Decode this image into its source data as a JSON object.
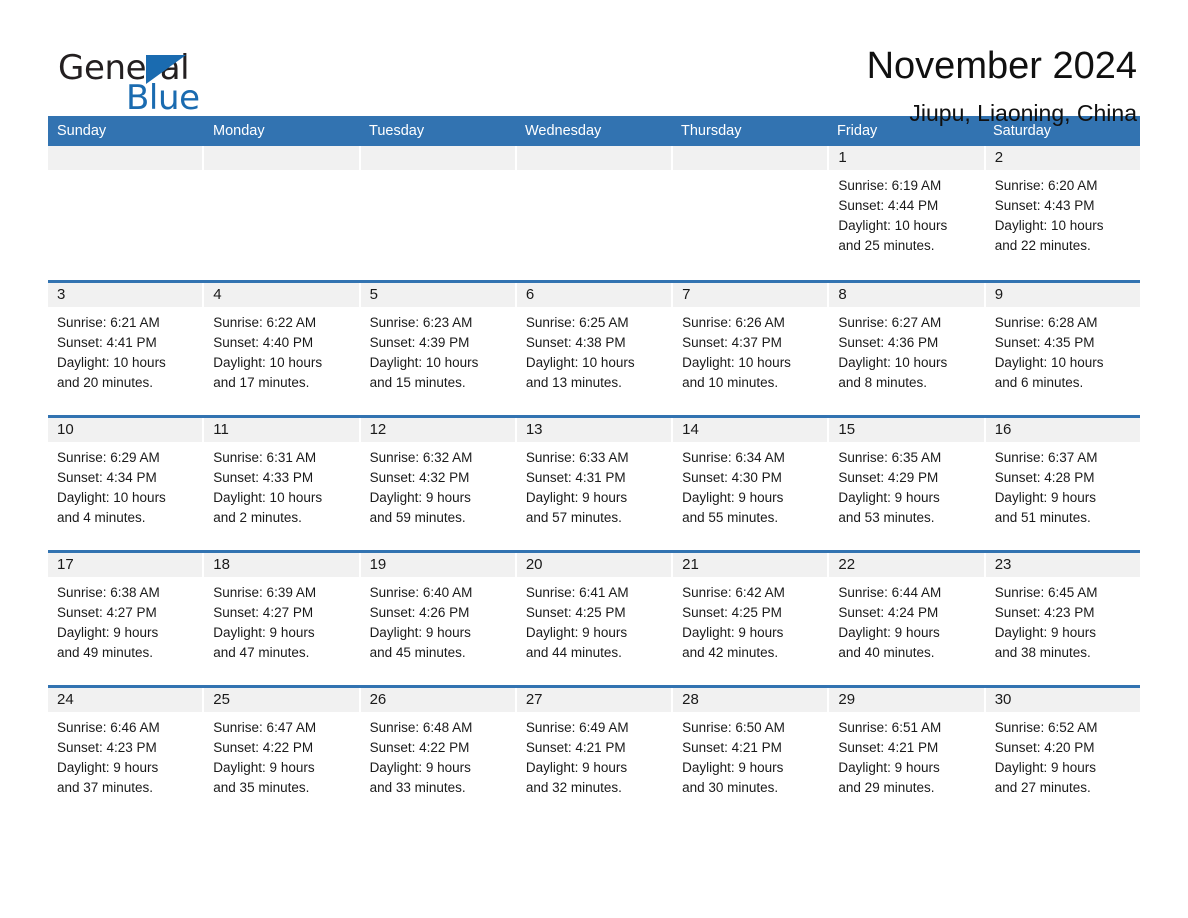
{
  "brand": {
    "name_part1": "General",
    "name_part2": "Blue",
    "triangle_color": "#1a6bb0"
  },
  "header": {
    "month_title": "November 2024",
    "location": "Jiupu, Liaoning, China"
  },
  "theme": {
    "header_blue": "#3273b1",
    "day_band_gray": "#f1f1f1",
    "text": "#1a1a1a",
    "page_background": "#ffffff"
  },
  "weekdays": [
    "Sunday",
    "Monday",
    "Tuesday",
    "Wednesday",
    "Thursday",
    "Friday",
    "Saturday"
  ],
  "weeks": [
    [
      {
        "day": "",
        "empty": true
      },
      {
        "day": "",
        "empty": true
      },
      {
        "day": "",
        "empty": true
      },
      {
        "day": "",
        "empty": true
      },
      {
        "day": "",
        "empty": true
      },
      {
        "day": "1",
        "sunrise": "Sunrise: 6:19 AM",
        "sunset": "Sunset: 4:44 PM",
        "daylight1": "Daylight: 10 hours",
        "daylight2": "and 25 minutes."
      },
      {
        "day": "2",
        "sunrise": "Sunrise: 6:20 AM",
        "sunset": "Sunset: 4:43 PM",
        "daylight1": "Daylight: 10 hours",
        "daylight2": "and 22 minutes."
      }
    ],
    [
      {
        "day": "3",
        "sunrise": "Sunrise: 6:21 AM",
        "sunset": "Sunset: 4:41 PM",
        "daylight1": "Daylight: 10 hours",
        "daylight2": "and 20 minutes."
      },
      {
        "day": "4",
        "sunrise": "Sunrise: 6:22 AM",
        "sunset": "Sunset: 4:40 PM",
        "daylight1": "Daylight: 10 hours",
        "daylight2": "and 17 minutes."
      },
      {
        "day": "5",
        "sunrise": "Sunrise: 6:23 AM",
        "sunset": "Sunset: 4:39 PM",
        "daylight1": "Daylight: 10 hours",
        "daylight2": "and 15 minutes."
      },
      {
        "day": "6",
        "sunrise": "Sunrise: 6:25 AM",
        "sunset": "Sunset: 4:38 PM",
        "daylight1": "Daylight: 10 hours",
        "daylight2": "and 13 minutes."
      },
      {
        "day": "7",
        "sunrise": "Sunrise: 6:26 AM",
        "sunset": "Sunset: 4:37 PM",
        "daylight1": "Daylight: 10 hours",
        "daylight2": "and 10 minutes."
      },
      {
        "day": "8",
        "sunrise": "Sunrise: 6:27 AM",
        "sunset": "Sunset: 4:36 PM",
        "daylight1": "Daylight: 10 hours",
        "daylight2": "and 8 minutes."
      },
      {
        "day": "9",
        "sunrise": "Sunrise: 6:28 AM",
        "sunset": "Sunset: 4:35 PM",
        "daylight1": "Daylight: 10 hours",
        "daylight2": "and 6 minutes."
      }
    ],
    [
      {
        "day": "10",
        "sunrise": "Sunrise: 6:29 AM",
        "sunset": "Sunset: 4:34 PM",
        "daylight1": "Daylight: 10 hours",
        "daylight2": "and 4 minutes."
      },
      {
        "day": "11",
        "sunrise": "Sunrise: 6:31 AM",
        "sunset": "Sunset: 4:33 PM",
        "daylight1": "Daylight: 10 hours",
        "daylight2": "and 2 minutes."
      },
      {
        "day": "12",
        "sunrise": "Sunrise: 6:32 AM",
        "sunset": "Sunset: 4:32 PM",
        "daylight1": "Daylight: 9 hours",
        "daylight2": "and 59 minutes."
      },
      {
        "day": "13",
        "sunrise": "Sunrise: 6:33 AM",
        "sunset": "Sunset: 4:31 PM",
        "daylight1": "Daylight: 9 hours",
        "daylight2": "and 57 minutes."
      },
      {
        "day": "14",
        "sunrise": "Sunrise: 6:34 AM",
        "sunset": "Sunset: 4:30 PM",
        "daylight1": "Daylight: 9 hours",
        "daylight2": "and 55 minutes."
      },
      {
        "day": "15",
        "sunrise": "Sunrise: 6:35 AM",
        "sunset": "Sunset: 4:29 PM",
        "daylight1": "Daylight: 9 hours",
        "daylight2": "and 53 minutes."
      },
      {
        "day": "16",
        "sunrise": "Sunrise: 6:37 AM",
        "sunset": "Sunset: 4:28 PM",
        "daylight1": "Daylight: 9 hours",
        "daylight2": "and 51 minutes."
      }
    ],
    [
      {
        "day": "17",
        "sunrise": "Sunrise: 6:38 AM",
        "sunset": "Sunset: 4:27 PM",
        "daylight1": "Daylight: 9 hours",
        "daylight2": "and 49 minutes."
      },
      {
        "day": "18",
        "sunrise": "Sunrise: 6:39 AM",
        "sunset": "Sunset: 4:27 PM",
        "daylight1": "Daylight: 9 hours",
        "daylight2": "and 47 minutes."
      },
      {
        "day": "19",
        "sunrise": "Sunrise: 6:40 AM",
        "sunset": "Sunset: 4:26 PM",
        "daylight1": "Daylight: 9 hours",
        "daylight2": "and 45 minutes."
      },
      {
        "day": "20",
        "sunrise": "Sunrise: 6:41 AM",
        "sunset": "Sunset: 4:25 PM",
        "daylight1": "Daylight: 9 hours",
        "daylight2": "and 44 minutes."
      },
      {
        "day": "21",
        "sunrise": "Sunrise: 6:42 AM",
        "sunset": "Sunset: 4:25 PM",
        "daylight1": "Daylight: 9 hours",
        "daylight2": "and 42 minutes."
      },
      {
        "day": "22",
        "sunrise": "Sunrise: 6:44 AM",
        "sunset": "Sunset: 4:24 PM",
        "daylight1": "Daylight: 9 hours",
        "daylight2": "and 40 minutes."
      },
      {
        "day": "23",
        "sunrise": "Sunrise: 6:45 AM",
        "sunset": "Sunset: 4:23 PM",
        "daylight1": "Daylight: 9 hours",
        "daylight2": "and 38 minutes."
      }
    ],
    [
      {
        "day": "24",
        "sunrise": "Sunrise: 6:46 AM",
        "sunset": "Sunset: 4:23 PM",
        "daylight1": "Daylight: 9 hours",
        "daylight2": "and 37 minutes."
      },
      {
        "day": "25",
        "sunrise": "Sunrise: 6:47 AM",
        "sunset": "Sunset: 4:22 PM",
        "daylight1": "Daylight: 9 hours",
        "daylight2": "and 35 minutes."
      },
      {
        "day": "26",
        "sunrise": "Sunrise: 6:48 AM",
        "sunset": "Sunset: 4:22 PM",
        "daylight1": "Daylight: 9 hours",
        "daylight2": "and 33 minutes."
      },
      {
        "day": "27",
        "sunrise": "Sunrise: 6:49 AM",
        "sunset": "Sunset: 4:21 PM",
        "daylight1": "Daylight: 9 hours",
        "daylight2": "and 32 minutes."
      },
      {
        "day": "28",
        "sunrise": "Sunrise: 6:50 AM",
        "sunset": "Sunset: 4:21 PM",
        "daylight1": "Daylight: 9 hours",
        "daylight2": "and 30 minutes."
      },
      {
        "day": "29",
        "sunrise": "Sunrise: 6:51 AM",
        "sunset": "Sunset: 4:21 PM",
        "daylight1": "Daylight: 9 hours",
        "daylight2": "and 29 minutes."
      },
      {
        "day": "30",
        "sunrise": "Sunrise: 6:52 AM",
        "sunset": "Sunset: 4:20 PM",
        "daylight1": "Daylight: 9 hours",
        "daylight2": "and 27 minutes."
      }
    ]
  ]
}
